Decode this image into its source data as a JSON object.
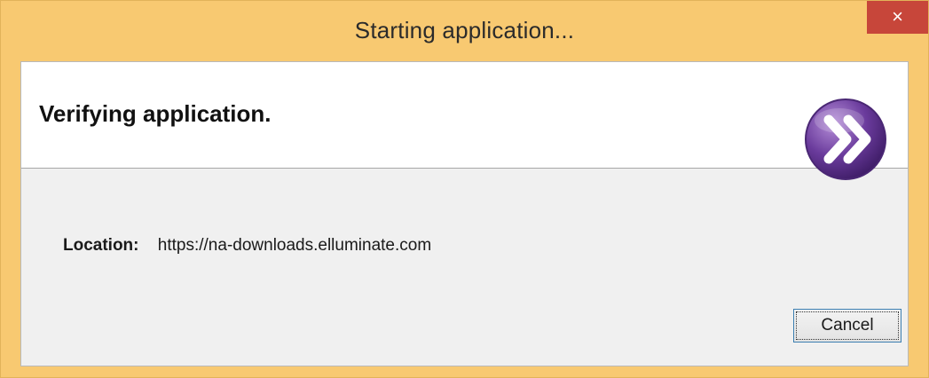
{
  "window": {
    "title": "Starting application...",
    "close_glyph": "×",
    "colors": {
      "frame": "#F8C971",
      "close_button": "#C7463A",
      "content_bg": "#F0F0F0",
      "logo_purple": "#6A3B9C"
    }
  },
  "header": {
    "heading": "Verifying application.",
    "logo_icon": "forward-chevrons-logo-icon"
  },
  "body": {
    "location_label": "Location:",
    "location_value": "https://na-downloads.elluminate.com"
  },
  "buttons": {
    "cancel_label": "Cancel"
  }
}
